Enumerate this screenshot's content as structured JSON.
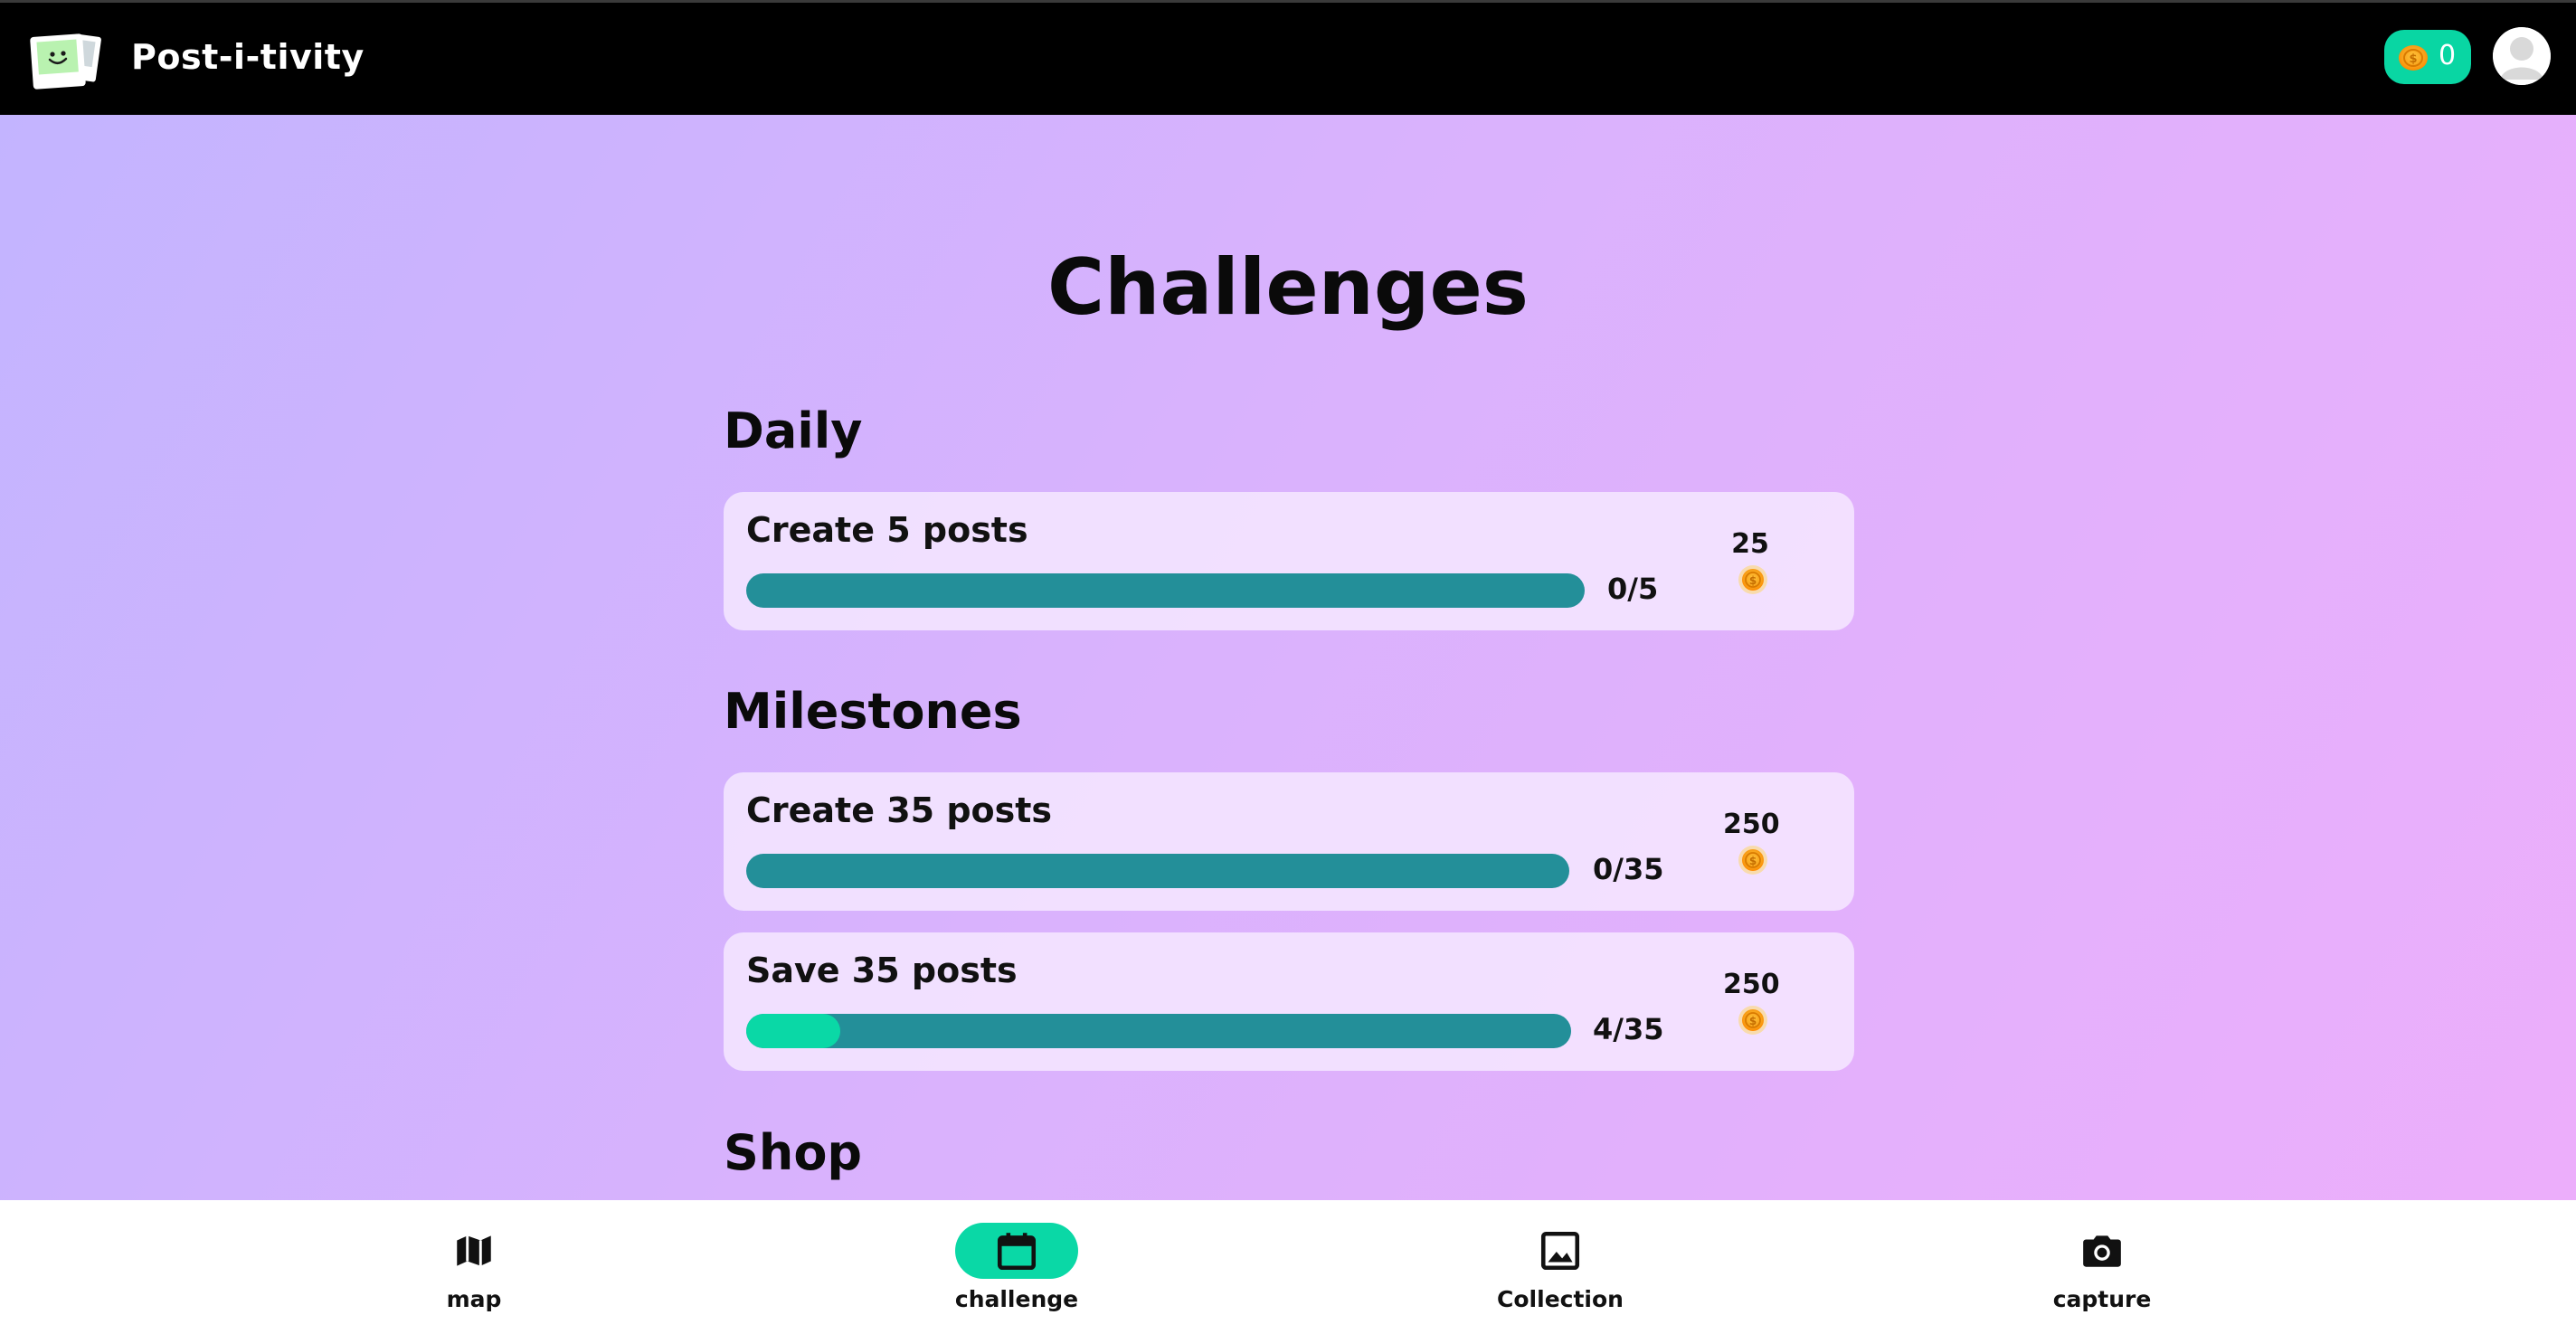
{
  "header": {
    "app_title": "Post-i-tivity",
    "logo_icon": "polaroid-smiley-logo",
    "coin_count": "0",
    "avatar_icon": "user-avatar-icon"
  },
  "main": {
    "page_title": "Challenges",
    "sections": {
      "daily": {
        "title": "Daily",
        "challenges": [
          {
            "title": "Create 5 posts",
            "progress_text": "0/5",
            "progress_value": 0,
            "reward": "25"
          }
        ]
      },
      "milestones": {
        "title": "Milestones",
        "challenges": [
          {
            "title": "Create 35 posts",
            "progress_text": "0/35",
            "progress_value": 0,
            "reward": "250"
          },
          {
            "title": "Save 35 posts",
            "progress_text": "4/35",
            "progress_value": 0.114,
            "reward": "250"
          }
        ]
      },
      "shop": {
        "title": "Shop"
      }
    }
  },
  "bottom_nav": {
    "items": [
      {
        "label": "map",
        "icon": "map-icon",
        "active": false
      },
      {
        "label": "challenge",
        "icon": "calendar-icon",
        "active": true
      },
      {
        "label": "Collection",
        "icon": "image-icon",
        "active": false
      },
      {
        "label": "capture",
        "icon": "camera-icon",
        "active": false
      }
    ]
  },
  "colors": {
    "accent": "#0ad8a6",
    "progress_track": "#238f99",
    "coin": "#f7a21b",
    "header_bg": "#000000"
  }
}
